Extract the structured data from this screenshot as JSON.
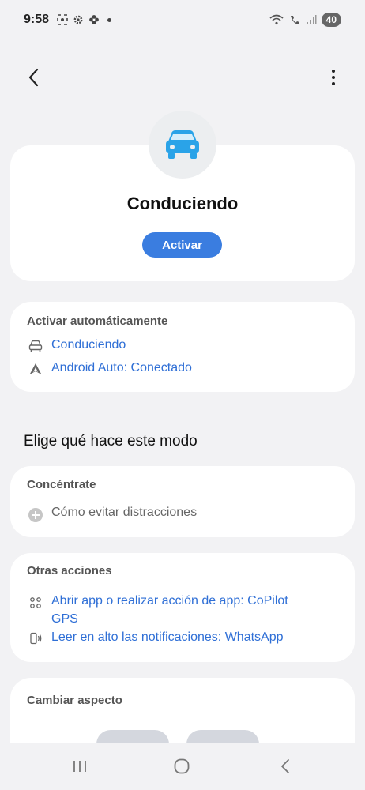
{
  "status_bar": {
    "time": "9:58",
    "battery": "40"
  },
  "mode": {
    "title": "Conduciendo",
    "activate_label": "Activar",
    "icon": "car-icon",
    "accent": "#3a7de0"
  },
  "auto_activate": {
    "title": "Activar automáticamente",
    "items": [
      {
        "icon": "car-outline-icon",
        "label": "Conduciendo"
      },
      {
        "icon": "android-auto-icon",
        "label": "Android Auto: Conectado"
      }
    ]
  },
  "section_heading": "Elige qué hace este modo",
  "focus": {
    "title": "Concéntrate",
    "item_label": "Cómo evitar distracciones"
  },
  "other_actions": {
    "title": "Otras acciones",
    "items": [
      {
        "icon": "apps-icon",
        "label_line1": "Abrir app o realizar acción de app: CoPilot",
        "label_line2": "GPS"
      },
      {
        "icon": "read-aloud-icon",
        "label_line1": "Leer en alto las notificaciones: WhatsApp"
      }
    ]
  },
  "appearance": {
    "title": "Cambiar aspecto"
  }
}
